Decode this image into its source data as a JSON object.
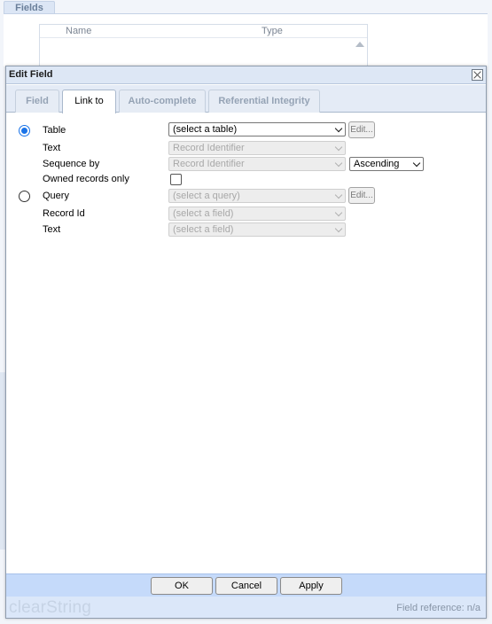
{
  "background": {
    "tab_label": "Fields",
    "grid_columns": [
      "Name",
      "Type"
    ]
  },
  "dialog": {
    "title": "Edit Field",
    "tabs": [
      {
        "label": "Field",
        "active": false
      },
      {
        "label": "Link to",
        "active": true
      },
      {
        "label": "Auto-complete",
        "active": false
      },
      {
        "label": "Referential Integrity",
        "active": false
      }
    ],
    "form": {
      "table_label": "Table",
      "table_select": "(select a table)",
      "table_edit": "Edit...",
      "text_label": "Text",
      "text_select": "Record Identifier",
      "sequence_label": "Sequence by",
      "sequence_select": "Record Identifier",
      "order_select": "Ascending",
      "owned_label": "Owned records only",
      "query_label": "Query",
      "query_select": "(select a query)",
      "query_edit": "Edit...",
      "record_id_label": "Record Id",
      "record_id_select": "(select a field)",
      "text2_label": "Text",
      "text2_select": "(select a field)"
    },
    "buttons": {
      "ok": "OK",
      "cancel": "Cancel",
      "apply": "Apply"
    },
    "status": {
      "brand": "clearString",
      "field_reference": "Field reference: n/a"
    }
  }
}
